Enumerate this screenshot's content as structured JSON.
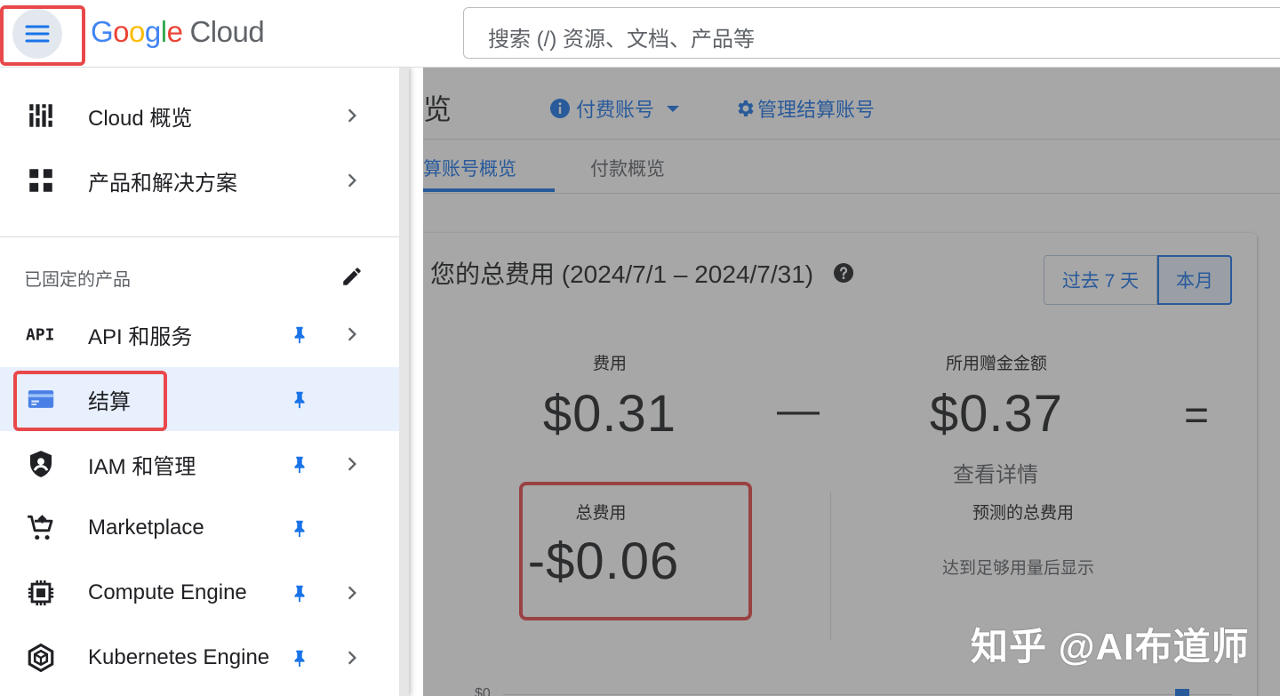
{
  "header": {
    "logo_parts": [
      "G",
      "o",
      "o",
      "g",
      "l",
      "e"
    ],
    "logo_suffix": "Cloud",
    "search_placeholder": "搜索 (/) 资源、文档、产品等"
  },
  "nav": {
    "top_items": [
      {
        "label": "Cloud 概览",
        "icon": "dashboard-icon"
      },
      {
        "label": "产品和解决方案",
        "icon": "grid-icon"
      }
    ],
    "pinned_section_title": "已固定的产品",
    "pinned_items": [
      {
        "label": "API 和服务",
        "icon": "api-icon"
      },
      {
        "label": "结算",
        "icon": "billing-card-icon"
      },
      {
        "label": "IAM 和管理",
        "icon": "shield-icon"
      },
      {
        "label": "Marketplace",
        "icon": "cart-icon"
      },
      {
        "label": "Compute Engine",
        "icon": "chip-icon"
      },
      {
        "label": "Kubernetes Engine",
        "icon": "kubernetes-icon"
      }
    ]
  },
  "main": {
    "page_title": "览",
    "account_label": "付费账号",
    "manage_label": "管理结算账号",
    "tabs": [
      "算账号概览",
      "付款概览"
    ],
    "card": {
      "title": "您的总费用 (2024/7/1 – 2024/7/31)",
      "range_buttons": [
        "过去 7 天",
        "本月"
      ],
      "cost_label": "费用",
      "cost_value": "$0.31",
      "minus": "—",
      "credits_label": "所用赠金金额",
      "credits_value": "$0.37",
      "equals": "=",
      "details_link": "查看详情",
      "total_label": "总费用",
      "total_value": "-$0.06",
      "forecast_label": "预测的总费用",
      "forecast_note": "达到足够用量后显示",
      "axis_label": "$0"
    }
  },
  "watermark": "知乎 @AI布道师",
  "colors": {
    "accent": "#1a73e8",
    "highlight": "#e8484a",
    "pin": "#1a73e8"
  }
}
